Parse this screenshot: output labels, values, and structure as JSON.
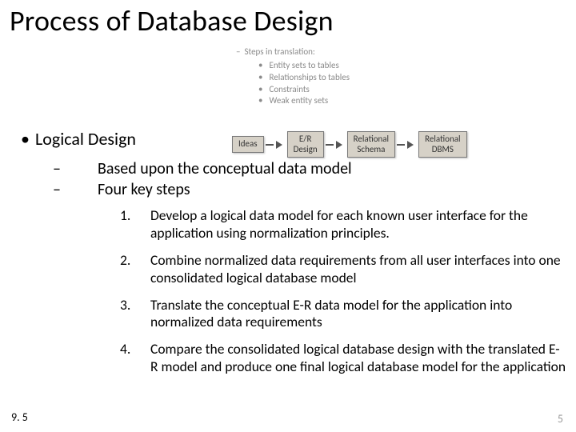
{
  "title": "Process of Database Design",
  "steps_header": "Steps in translation:",
  "steps": {
    "s1": "Entity sets to tables",
    "s2": "Relationships to tables",
    "s3": "Constraints",
    "s4": "Weak entity sets"
  },
  "diagram": {
    "n1": "Ideas",
    "n2": "E/R\nDesign",
    "n3": "Relational\nSchema",
    "n4": "Relational\nDBMS"
  },
  "lvl1": "Logical Design",
  "lvl2a": "Based upon the conceptual data model",
  "lvl2b": "Four key steps",
  "ol": {
    "n1": "1.",
    "t1": "Develop a logical data model for each known user interface for the application using normalization principles.",
    "n2": "2.",
    "t2": "Combine normalized data requirements from all user interfaces into one consolidated logical database model",
    "n3": "3.",
    "t3": "Translate the conceptual E-R data model for the application into normalized data requirements",
    "n4": "4.",
    "t4": "Compare the consolidated logical database design with the translated E-R model and produce one final logical database model for the application"
  },
  "footer_left": "9. 5",
  "footer_right": "5"
}
